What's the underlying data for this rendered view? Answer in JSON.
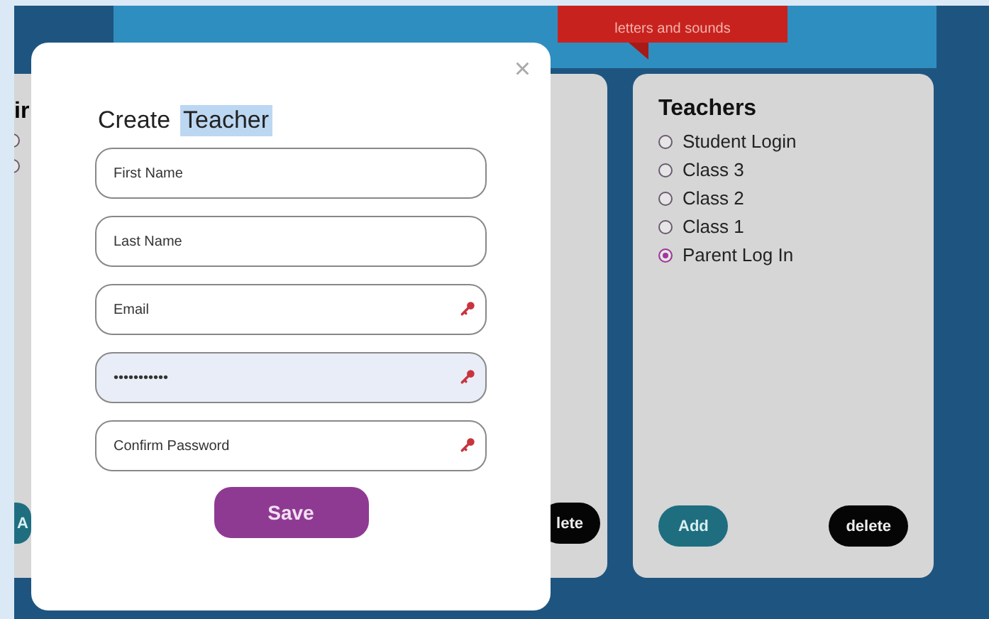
{
  "banner": {
    "text": "letters and sounds"
  },
  "left_card": {
    "title": "ir",
    "radios": [
      {
        "selected": false
      },
      {
        "selected": false
      }
    ],
    "add_button": "A",
    "delete_button": "lete"
  },
  "teachers_card": {
    "title": "Teachers",
    "options": [
      {
        "label": "Student Login",
        "selected": false
      },
      {
        "label": "Class 3",
        "selected": false
      },
      {
        "label": "Class 2",
        "selected": false
      },
      {
        "label": "Class 1",
        "selected": false
      },
      {
        "label": "Parent Log In",
        "selected": true
      }
    ],
    "add_button": "Add",
    "delete_button": "delete"
  },
  "modal": {
    "close": "×",
    "title": [
      {
        "text": "Create",
        "highlighted": false
      },
      {
        "text": "Teacher",
        "highlighted": true
      }
    ],
    "fields": [
      {
        "placeholder": "First Name",
        "key_icon": false,
        "autofilled": false
      },
      {
        "placeholder": "Last Name",
        "key_icon": false,
        "autofilled": false
      },
      {
        "placeholder": "Email",
        "key_icon": true,
        "autofilled": false
      },
      {
        "value": "•••••••••••",
        "key_icon": true,
        "autofilled": true
      },
      {
        "placeholder": "Confirm Password",
        "key_icon": true,
        "autofilled": false
      }
    ],
    "save_button": "Save"
  }
}
